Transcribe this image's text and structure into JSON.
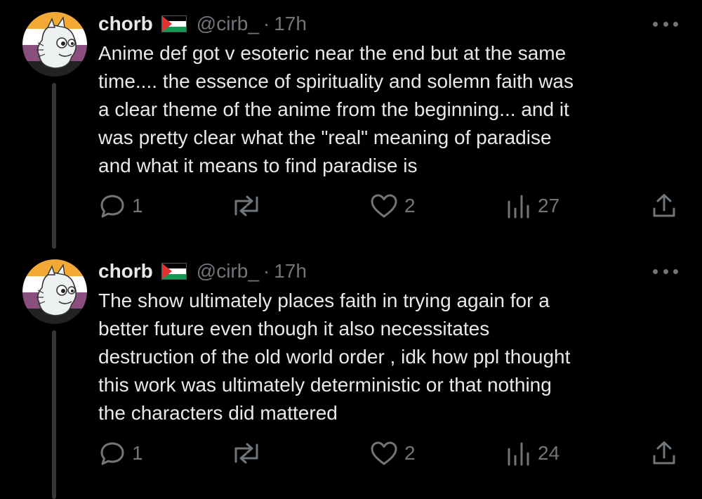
{
  "tweets": [
    {
      "author": {
        "name": "chorb",
        "flag": "palestine-flag",
        "handle": "@cirb_",
        "separator": "·",
        "time": "17h"
      },
      "text_lines": [
        "Anime def got v esoteric near the end but at the same",
        "time.... the essence of spirituality and solemn faith was",
        "a clear theme of the anime from the beginning... and it",
        "was pretty clear what the \"real\" meaning of paradise",
        "and what it means to find paradise is"
      ],
      "actions": {
        "reply_count": "1",
        "retweet_count": "",
        "like_count": "2",
        "view_count": "27"
      }
    },
    {
      "author": {
        "name": "chorb",
        "flag": "palestine-flag",
        "handle": "@cirb_",
        "separator": "·",
        "time": "17h"
      },
      "text_lines": [
        "The show ultimately places faith in trying again for a",
        "better future even though it also necessitates",
        "destruction of the old world order , idk how ppl thought",
        "this work was ultimately deterministic or that nothing",
        "the characters did mattered"
      ],
      "actions": {
        "reply_count": "1",
        "retweet_count": "",
        "like_count": "2",
        "view_count": "24"
      }
    }
  ],
  "icons": {
    "reply": "speech-bubble-icon",
    "retweet": "retweet-icon",
    "like": "heart-icon",
    "views": "bar-chart-icon",
    "share": "share-upload-icon",
    "more": "more-dots-icon"
  },
  "colors": {
    "background": "#000000",
    "text": "#e7e9ea",
    "secondary": "#71767b",
    "thread_line": "#333639",
    "avatar_bands": [
      "#f4a935",
      "#ffffff",
      "#8a4f7d",
      "#222222"
    ]
  }
}
